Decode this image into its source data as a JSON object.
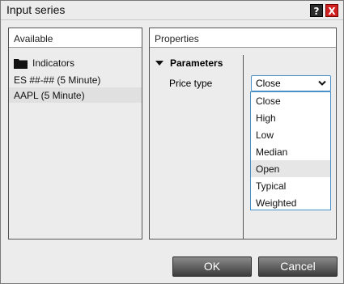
{
  "window": {
    "title": "Input series",
    "help_label": "?",
    "close_label": "X"
  },
  "available": {
    "header": "Available",
    "items": [
      {
        "label": "Indicators",
        "icon": "folder-icon"
      },
      {
        "label": "ES ##-## (5 Minute)"
      },
      {
        "label": "AAPL (5 Minute)",
        "selected": true
      }
    ]
  },
  "properties": {
    "header": "Properties",
    "section": "Parameters",
    "price_type_label": "Price type",
    "price_type_value": "Close",
    "options": [
      "Close",
      "High",
      "Low",
      "Median",
      "Open",
      "Typical",
      "Weighted"
    ],
    "hovered_option": "Open"
  },
  "buttons": {
    "ok": "OK",
    "cancel": "Cancel"
  }
}
